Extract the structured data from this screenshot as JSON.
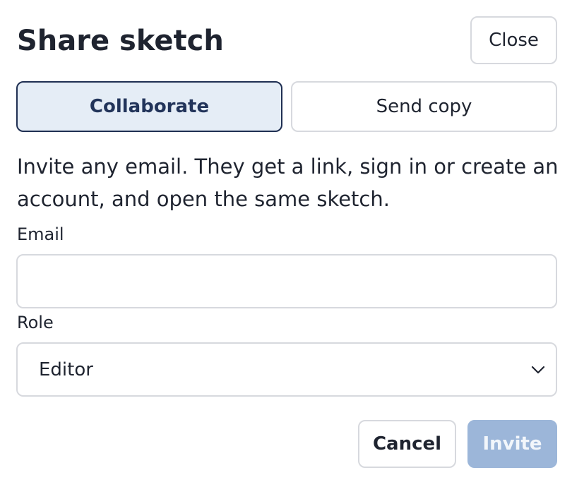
{
  "dialog": {
    "title": "Share sketch",
    "close_label": "Close"
  },
  "mode_tabs": [
    {
      "label": "Collaborate",
      "selected": true
    },
    {
      "label": "Send copy",
      "selected": false
    }
  ],
  "description": "Invite any email. They get a link, sign in or create an account, and open the same sketch.",
  "form": {
    "email_label": "Email",
    "email_value": "",
    "email_placeholder": "",
    "role_label": "Role",
    "role_selected": "Editor"
  },
  "actions": {
    "cancel_label": "Cancel",
    "invite_label": "Invite",
    "invite_disabled": true
  },
  "colors": {
    "selected_tab_bg": "#e5edf6",
    "selected_tab_border": "#1f2f52",
    "invite_disabled_bg": "#9cb6d9"
  }
}
